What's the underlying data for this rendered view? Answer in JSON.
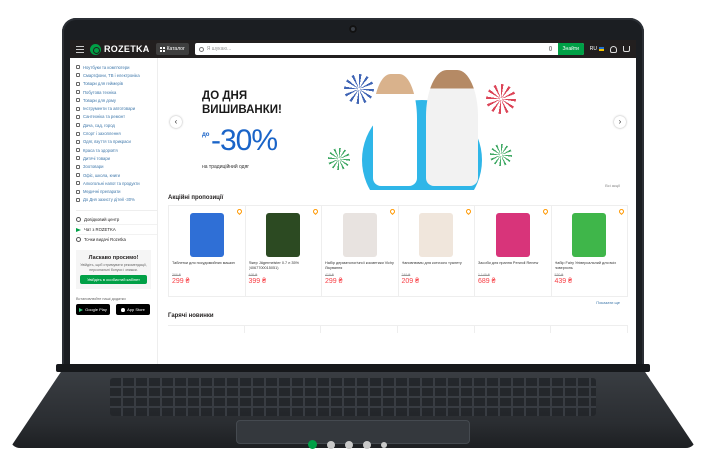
{
  "header": {
    "logo": "ROZETKA",
    "catalog": "Каталог",
    "search_placeholder": "Я шукаю...",
    "search_button": "Знайти",
    "lang": "RU"
  },
  "sidebar": {
    "categories": [
      "Ноутбуки та комп'ютери",
      "Смартфони, ТВ і електроніка",
      "Товари для геймерів",
      "Побутова техніка",
      "Товари для дому",
      "Інструменти та автотовари",
      "Сантехніка та ремонт",
      "Дача, сад, город",
      "Спорт і захоплення",
      "Одяг, взуття та прикраси",
      "Краса та здоров'я",
      "Дитячі товари",
      "Зоотовари",
      "Офіс, школа, книги",
      "Алкогольні напої та продукти",
      "Медичні препарати",
      "До Дня захисту дітей -30%"
    ],
    "links": [
      "Довідковий центр",
      "Чат з ROZETKA",
      "Точки видачі Rozetka"
    ],
    "welcome_title": "Ласкаво просимо!",
    "welcome_text": "Увійдіть, щоб отримувати рекомендації, персональні бонуси і знижки.",
    "welcome_button": "Увійдіть в особистий кабінет",
    "apps_title": "Встановлюйте наші додатки",
    "google_play": "Google Play",
    "app_store": "App Store"
  },
  "banner": {
    "line1": "ДО ДНЯ",
    "line2": "ВИШИВАНКИ!",
    "upto": "до",
    "discount": "-30%",
    "subtitle": "на традиційний одяг",
    "see_all": "Всі акції"
  },
  "promo_section": "Акційні пропозиції",
  "products": [
    {
      "name": "Таблетки для посудомийних машин",
      "old": "366 ₴",
      "price": "299 ₴",
      "color": "#2f6fd6"
    },
    {
      "name": "Лікер Jägermeister 0.7 л 35% (4067700015051)",
      "old": "495 ₴",
      "price": "399 ₴",
      "color": "#2c4a22"
    },
    {
      "name": "Набір дерматологічної косметики Vichy Лікування",
      "old": "419 ₴",
      "price": "299 ₴",
      "color": "#e8e3e0"
    },
    {
      "name": "Наповнювач для котячого туалету",
      "old": "249 ₴",
      "price": "209 ₴",
      "color": "#f0e6dc"
    },
    {
      "name": "Засоби для прання Perwoll Renew",
      "old": "1 149 ₴",
      "price": "689 ₴",
      "color": "#d8347a"
    },
    {
      "name": "Набір Fairy Універсальний для всіх поверхонь",
      "old": "530 ₴",
      "price": "439 ₴",
      "color": "#3fb64a"
    }
  ],
  "more_button": "Показати ще",
  "new_section": "Гарячі новинки",
  "carousel": {
    "active": 1,
    "count": 5
  }
}
